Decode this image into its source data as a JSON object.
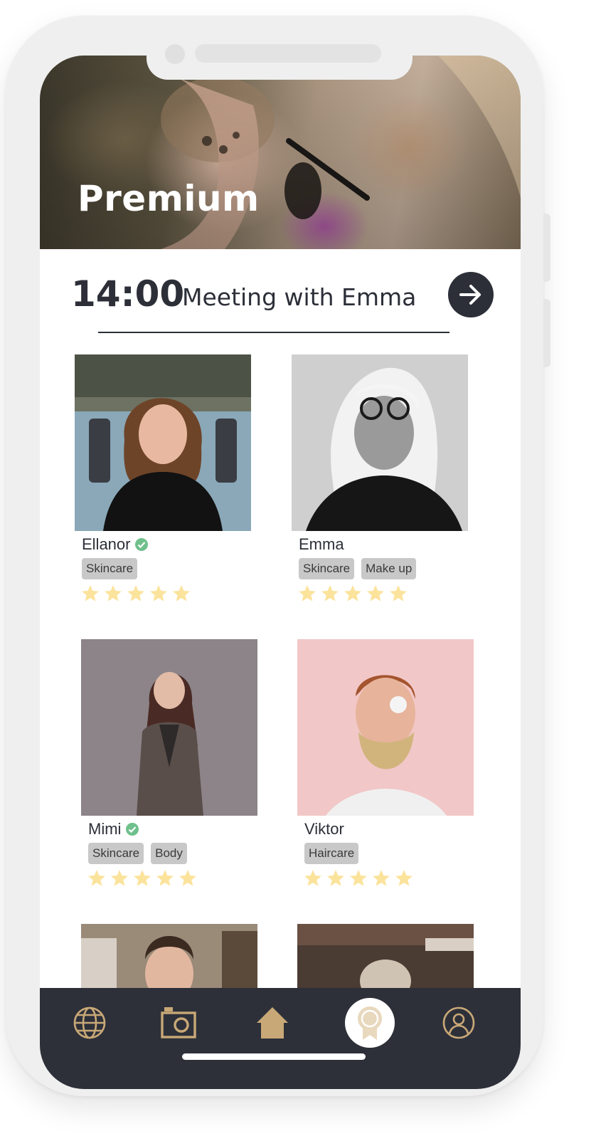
{
  "hero": {
    "title": "Premium"
  },
  "meeting": {
    "time": "14:00",
    "text": "Meeting with Emma"
  },
  "colors": {
    "dark": "#2d3039",
    "gold": "#c9a877",
    "star": "#fbe39c",
    "verified": "#6fc08b",
    "tag_bg": "#c8c8c8"
  },
  "profiles": [
    {
      "name": "Ellanor",
      "verified": true,
      "tags": [
        "Skincare"
      ],
      "rating": 5
    },
    {
      "name": "Emma",
      "verified": false,
      "tags": [
        "Skincare",
        "Make up"
      ],
      "rating": 5
    },
    {
      "name": "Mimi",
      "verified": true,
      "tags": [
        "Skincare",
        "Body"
      ],
      "rating": 5
    },
    {
      "name": "Viktor",
      "verified": false,
      "tags": [
        "Haircare"
      ],
      "rating": 5
    }
  ],
  "nav": {
    "items": [
      {
        "icon": "globe-icon",
        "active": false
      },
      {
        "icon": "camera-icon",
        "active": false
      },
      {
        "icon": "home-icon",
        "active": false
      },
      {
        "icon": "award-icon",
        "active": true
      },
      {
        "icon": "profile-icon",
        "active": false
      }
    ]
  }
}
